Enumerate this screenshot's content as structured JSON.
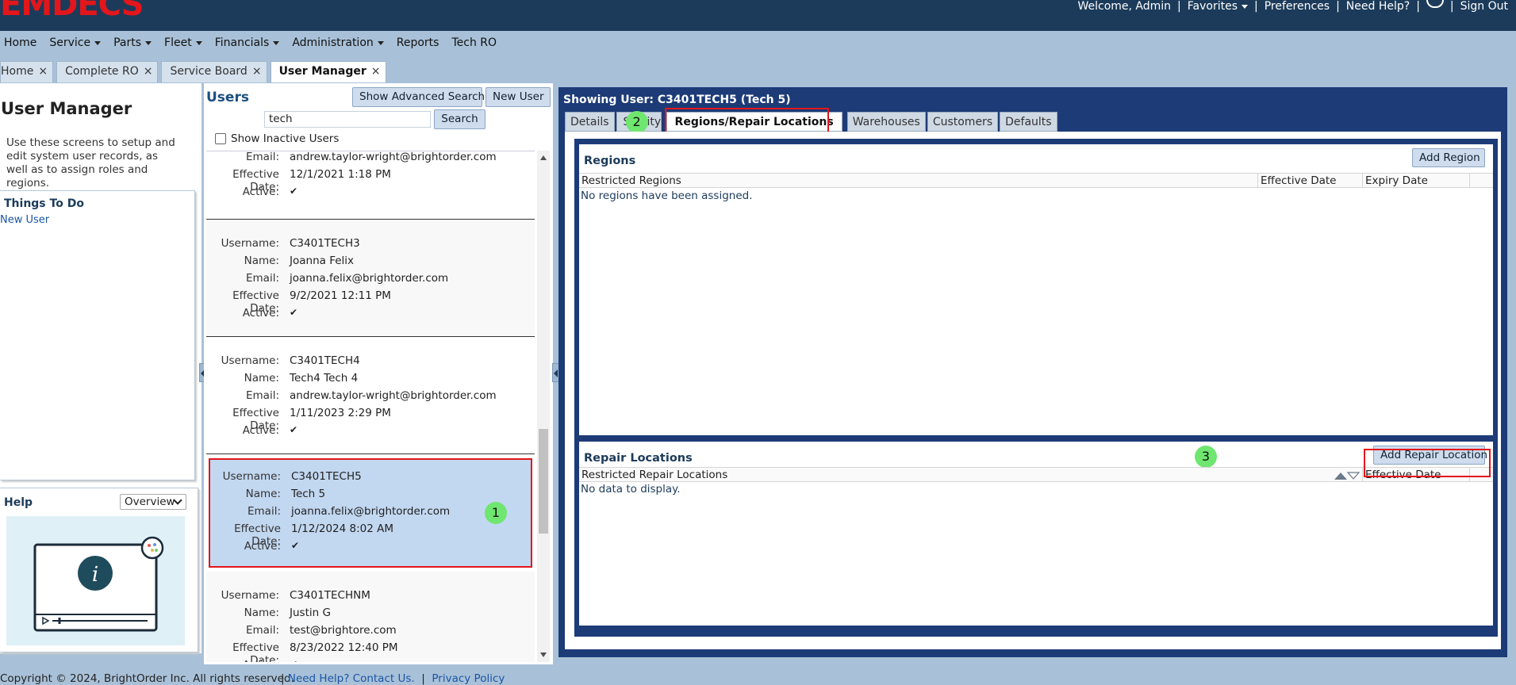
{
  "brand": {
    "logo_text": "EMDECS",
    "logo_color": "#e3161b",
    "header_bg": "#1c3b5a"
  },
  "toplinks": {
    "welcome": "Welcome, Admin",
    "favorites": "Favorites",
    "preferences": "Preferences",
    "need_help": "Need Help?",
    "sign_out": "Sign Out"
  },
  "menu": {
    "items": [
      "Home",
      "Service",
      "Parts",
      "Fleet",
      "Financials",
      "Administration",
      "Reports",
      "Tech RO"
    ]
  },
  "doc_tabs": {
    "items": [
      "Home",
      "Complete RO",
      "Service Board",
      "User Manager"
    ],
    "close": "×"
  },
  "left": {
    "title": "User Manager",
    "description": "Use these screens to setup and edit system user records, as well as to assign roles and regions.",
    "todo_title": "Things To Do",
    "todo_link": "New User",
    "help_title": "Help",
    "help_select": "Overview"
  },
  "users": {
    "title": "Users",
    "advanced_search": "Show Advanced Search",
    "new_user": "New User",
    "search_value": "tech",
    "search_button": "Search",
    "show_inactive": "Show Inactive Users",
    "labels": {
      "username": "Username:",
      "name": "Name:",
      "email": "Email:",
      "effective": "Effective Date:",
      "active": "Active:"
    },
    "active_mark": "✔",
    "records": [
      {
        "username": "",
        "name": "",
        "email": "andrew.taylor-wright@brightorder.com",
        "effective": "12/1/2021 1:18 PM"
      },
      {
        "username": "C3401TECH3",
        "name": "Joanna Felix",
        "email": "joanna.felix@brightorder.com",
        "effective": "9/2/2021 12:11 PM"
      },
      {
        "username": "C3401TECH4",
        "name": "Tech4 Tech 4",
        "email": "andrew.taylor-wright@brightorder.com",
        "effective": "1/11/2023 2:29 PM"
      },
      {
        "username": "C3401TECH5",
        "name": "Tech 5",
        "email": "joanna.felix@brightorder.com",
        "effective": "1/12/2024 8:02 AM"
      },
      {
        "username": "C3401TECHNM",
        "name": "Justin G",
        "email": "test@brightore.com",
        "effective": "8/23/2022 12:40 PM"
      }
    ]
  },
  "detail": {
    "title": "Showing User: C3401TECH5 (Tech 5)",
    "tabs": [
      "Details",
      "Security",
      "Regions/Repair Locations",
      "Warehouses",
      "Customers",
      "Defaults"
    ],
    "tab_security_visible": "Se",
    "tab_security_tail": "ity",
    "regions": {
      "title": "Regions",
      "add_button": "Add Region",
      "columns": [
        "Restricted Regions",
        "Effective Date",
        "Expiry Date"
      ],
      "empty": "No regions have been assigned."
    },
    "repair": {
      "title": "Repair Locations",
      "add_button": "Add Repair Location",
      "columns": [
        "Restricted Repair Locations",
        "Effective Date"
      ],
      "empty": "No data to display."
    }
  },
  "badges": [
    "1",
    "2",
    "3"
  ],
  "footer": {
    "copyright": "Copyright © 2024, BrightOrder Inc. All rights reserved.",
    "help_link": "Need Help? Contact Us.",
    "privacy_link": "Privacy Policy"
  }
}
